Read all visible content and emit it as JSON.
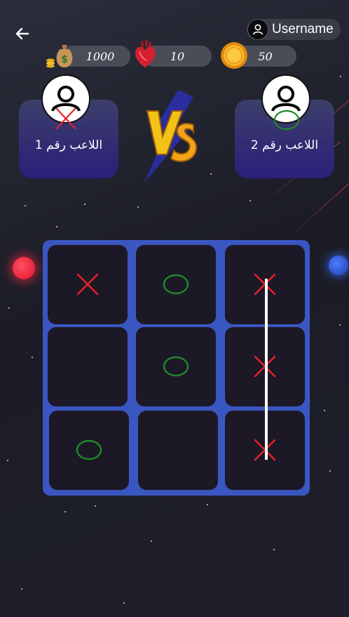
{
  "header": {
    "username": "Username"
  },
  "stats": {
    "money": "1000",
    "lives": "10",
    "coins": "50"
  },
  "players": {
    "player1": {
      "label": "اللاعب رقم 1",
      "mark": "X"
    },
    "player2": {
      "label": "اللاعب رقم 2",
      "mark": "O"
    }
  },
  "board": {
    "cells": [
      "X",
      "O",
      "X",
      "",
      "O",
      "X",
      "O",
      "",
      "X"
    ],
    "winning_line": "column-3"
  },
  "colors": {
    "x_mark": "#e8202a",
    "o_mark": "#1f8a2a",
    "board": "#3a56c0",
    "cell": "#1c1826",
    "card_top": "#3c3f6a",
    "card_bottom": "#2b1f7a"
  }
}
